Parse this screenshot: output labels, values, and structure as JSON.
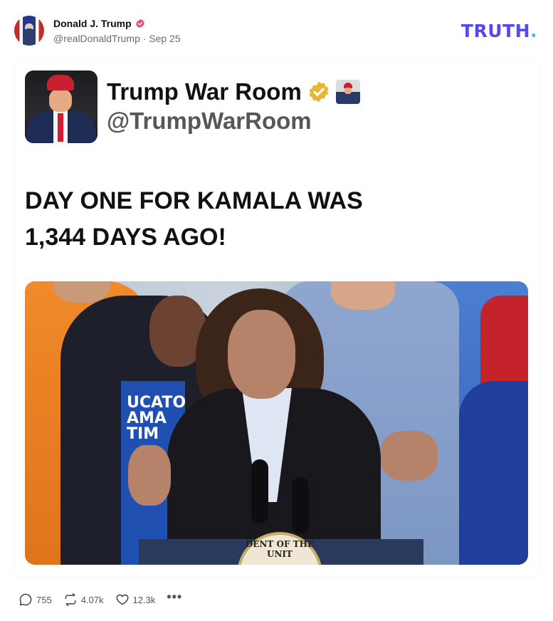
{
  "post": {
    "author_name": "Donald J. Trump",
    "handle": "@realDonaldTrump",
    "separator": "·",
    "date": "Sep 25"
  },
  "brand": {
    "logo_text": "TRUTH",
    "logo_dot": ".",
    "colors": {
      "logo": "#5448ee",
      "logo_dot": "#27c9d6",
      "verified": "#e34f6e"
    }
  },
  "embed": {
    "display_name": "Trump War Room",
    "handle": "@TrumpWarRoom",
    "headline_line1": "DAY ONE FOR KAMALA WAS",
    "headline_line2": "1,344 DAYS AGO!",
    "photo_sign_text": "UCATO\nAMA\nTIM",
    "seal_text": "DENT OF THE UNIT"
  },
  "actions": {
    "replies": "755",
    "retruths": "4.07k",
    "likes": "12.3k",
    "more": "•••"
  },
  "icons": [
    "verified-badge-icon",
    "gold-verified-icon",
    "reply-icon",
    "retruth-icon",
    "heart-icon",
    "more-icon"
  ]
}
